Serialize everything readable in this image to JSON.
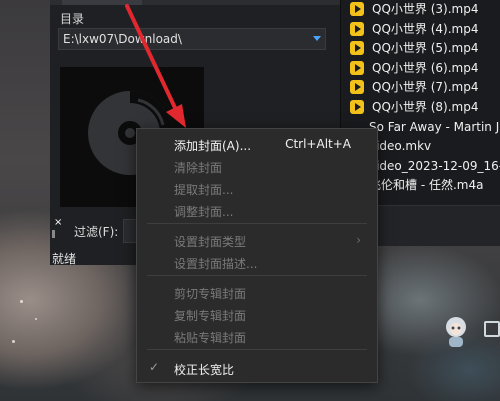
{
  "app": {
    "dir_label": "目录",
    "dir_value": "E:\\lxw07\\Download\\",
    "filter_label": "过滤(F):",
    "status": "就绪",
    "close_glyph": "×"
  },
  "file_list": [
    {
      "name": "QQ小世界 (3).mp4",
      "icon": "play-file-icon"
    },
    {
      "name": "QQ小世界 (4).mp4",
      "icon": "play-file-icon"
    },
    {
      "name": "QQ小世界 (5).mp4",
      "icon": "play-file-icon"
    },
    {
      "name": "QQ小世界 (6).mp4",
      "icon": "play-file-icon"
    },
    {
      "name": "QQ小世界 (7).mp4",
      "icon": "play-file-icon"
    },
    {
      "name": "QQ小世界 (8).mp4",
      "icon": "play-file-icon"
    },
    {
      "name": "So Far Away - Martin J",
      "icon": ""
    },
    {
      "name": "video.mkv",
      "icon": ""
    },
    {
      "name": "video_2023-12-09_16-",
      "icon": ""
    },
    {
      "name": "飞伦和槽 - 任然.m4a",
      "icon": ""
    }
  ],
  "context_menu": {
    "items": [
      {
        "label": "添加封面(A)...",
        "shortcut": "Ctrl+Alt+A",
        "enabled": true
      },
      {
        "label": "清除封面",
        "enabled": false
      },
      {
        "label": "提取封面...",
        "enabled": false
      },
      {
        "label": "调整封面...",
        "enabled": false
      },
      {
        "label": "设置封面类型",
        "enabled": false,
        "submenu": true
      },
      {
        "label": "设置封面描述...",
        "enabled": false
      },
      {
        "label": "剪切专辑封面",
        "enabled": false
      },
      {
        "label": "复制专辑封面",
        "enabled": false
      },
      {
        "label": "粘贴专辑封面",
        "enabled": false
      },
      {
        "label": "校正长宽比",
        "enabled": true,
        "checked": true
      }
    ],
    "submenu_glyph": "›",
    "check_glyph": "✓"
  },
  "colors": {
    "annotation_arrow": "#e0282e",
    "file_icon": "#f2c21b",
    "dropdown_accent": "#4aa3ff"
  }
}
